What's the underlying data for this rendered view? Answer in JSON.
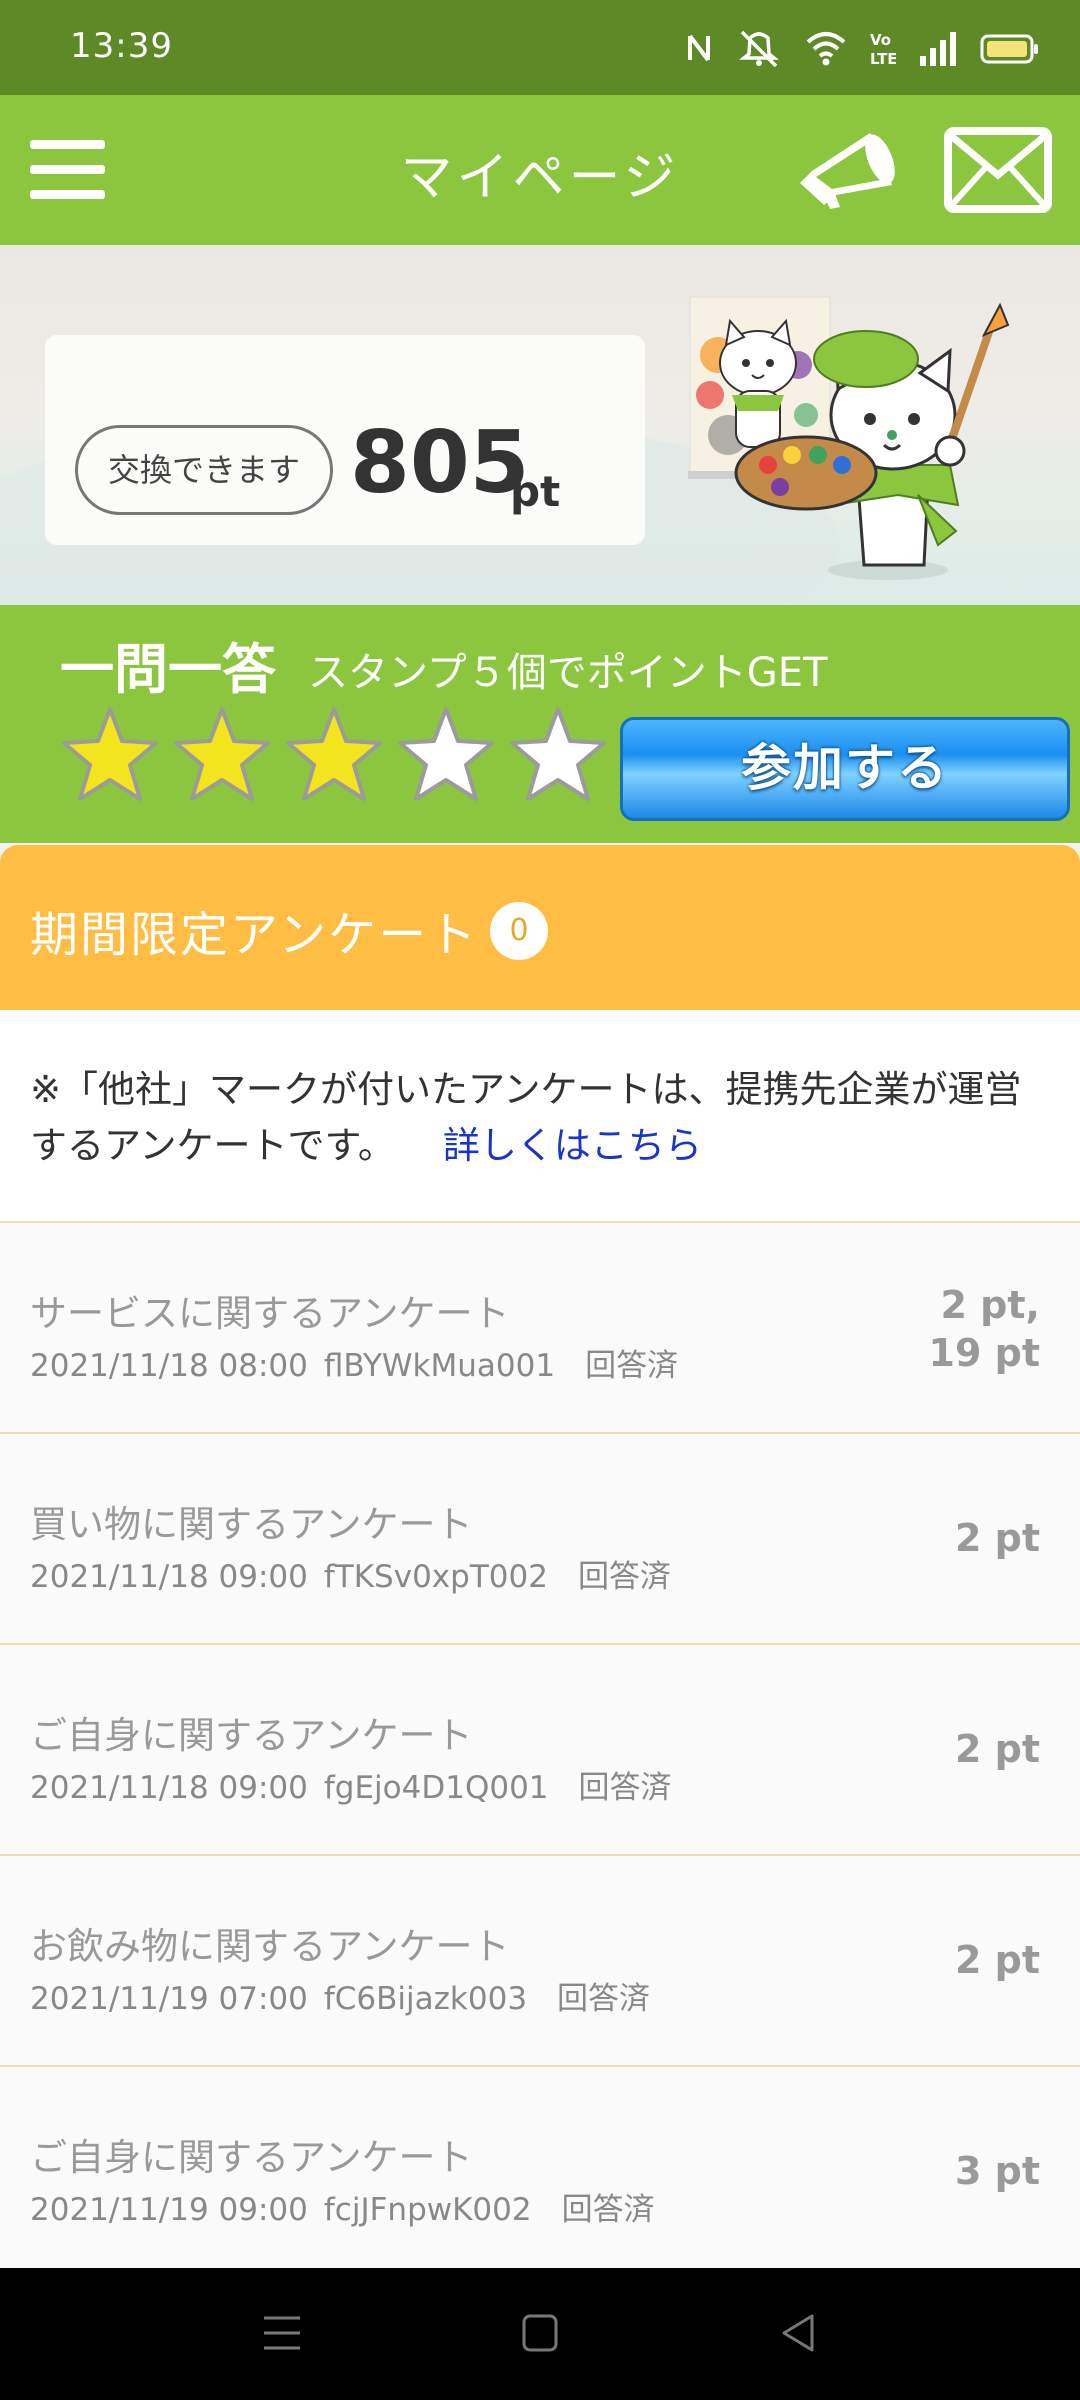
{
  "status_bar": {
    "time": "13:39",
    "icons": [
      "nfc-icon",
      "mute-icon",
      "wifi-icon",
      "volte-icon",
      "signal-icon",
      "battery-icon"
    ]
  },
  "header": {
    "title": "マイページ",
    "icons": [
      "menu-icon",
      "megaphone-icon",
      "mail-icon"
    ]
  },
  "points": {
    "exchange_label": "交換できます",
    "value": "805",
    "unit": "pt"
  },
  "qa": {
    "title": "一問一答",
    "description": "スタンプ５個でポイントGET",
    "stamps_filled": 3,
    "stamps_total": 5,
    "join_label": "参加する"
  },
  "survey": {
    "title": "期間限定アンケート",
    "count": "0",
    "notice": "※「他社」マークが付いたアンケートは、提携先企業が運営するアンケートです。",
    "notice_link": "詳しくはこちら",
    "items": [
      {
        "title": "サービスに関するアンケート",
        "date": "2021/11/18 08:00",
        "code": "flBYWkMua001",
        "status": "回答済",
        "points_line1": "2 pt,",
        "points_line2": "19 pt"
      },
      {
        "title": "買い物に関するアンケート",
        "date": "2021/11/18 09:00",
        "code": "fTKSv0xpT002",
        "status": "回答済",
        "points_line1": "2 pt"
      },
      {
        "title": "ご自身に関するアンケート",
        "date": "2021/11/18 09:00",
        "code": "fgEjo4D1Q001",
        "status": "回答済",
        "points_line1": "2 pt"
      },
      {
        "title": "お飲み物に関するアンケート",
        "date": "2021/11/19 07:00",
        "code": "fC6Bijazk003",
        "status": "回答済",
        "points_line1": "2 pt"
      },
      {
        "title": "ご自身に関するアンケート",
        "date": "2021/11/19 09:00",
        "code": "fcjJFnpwK002",
        "status": "回答済",
        "points_line1": "3 pt"
      }
    ]
  },
  "nav": {
    "buttons": [
      "recent-apps-icon",
      "home-icon",
      "back-icon"
    ]
  },
  "colors": {
    "status_bar": "#5d8a27",
    "header": "#8cc63f",
    "survey_header": "#ffbe43",
    "link": "#1a35c8",
    "star_filled": "#f2e51d"
  }
}
